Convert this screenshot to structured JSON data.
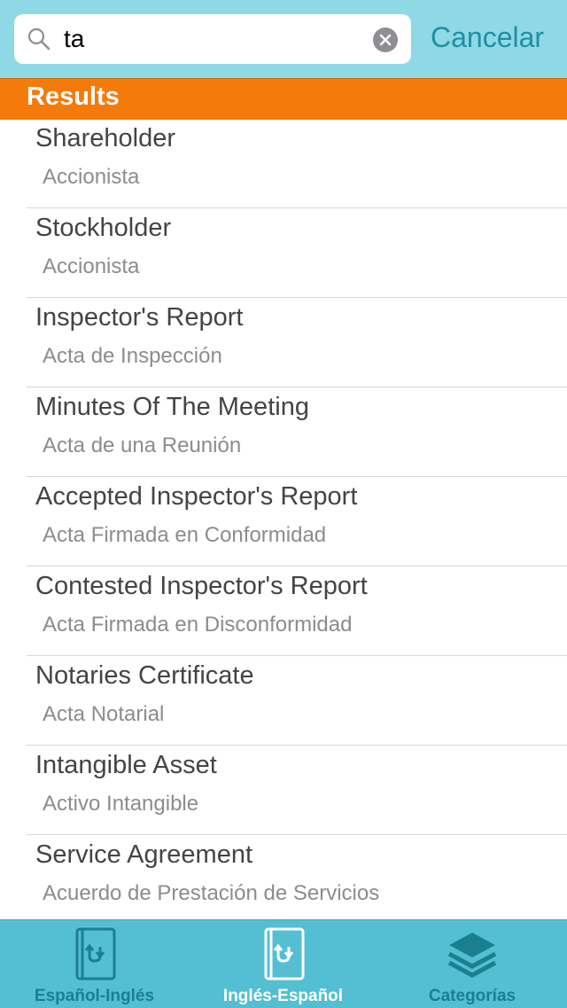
{
  "search": {
    "value": "ta",
    "cancel_label": "Cancelar"
  },
  "section": {
    "title": "Results"
  },
  "results": [
    {
      "term": "Shareholder",
      "translation": "Accionista"
    },
    {
      "term": "Stockholder",
      "translation": "Accionista"
    },
    {
      "term": "Inspector's Report",
      "translation": "Acta de Inspección"
    },
    {
      "term": "Minutes Of The Meeting",
      "translation": "Acta de una Reunión"
    },
    {
      "term": "Accepted Inspector's Report",
      "translation": "Acta Firmada en Conformidad"
    },
    {
      "term": "Contested Inspector's Report",
      "translation": "Acta Firmada en Disconformidad"
    },
    {
      "term": "Notaries Certificate",
      "translation": "Acta Notarial"
    },
    {
      "term": "Intangible Asset",
      "translation": "Activo Intangible"
    },
    {
      "term": "Service Agreement",
      "translation": "Acuerdo de Prestación de Servicios"
    }
  ],
  "tabs": [
    {
      "label": "Español-Inglés",
      "icon": "book-swap-icon",
      "active": false
    },
    {
      "label": "Inglés-Español",
      "icon": "book-swap-icon",
      "active": true
    },
    {
      "label": "Categorías",
      "icon": "layers-icon",
      "active": false
    }
  ],
  "colors": {
    "topbar": "#8fd8e5",
    "accent": "#f47a0a",
    "tabbar": "#54bfd2",
    "link": "#1f8fa0"
  }
}
